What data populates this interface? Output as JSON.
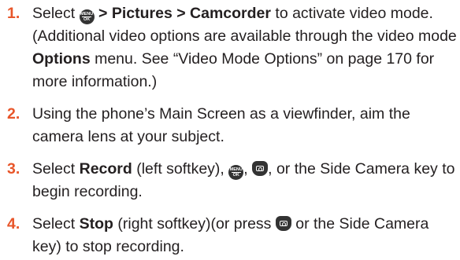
{
  "steps": [
    {
      "number": "1.",
      "t_select": "Select ",
      "menu_icon_top": "MENU",
      "menu_icon_bottom": "OK",
      "path1": " > Pictures > Camcorder",
      "t1": " to activate video mode. (Additional video options are available through the video mode ",
      "options": "Options",
      "t2": " menu. See “Video Mode Options” on page 170 for more information.)"
    },
    {
      "number": "2.",
      "text": "Using the phone’s Main Screen as a viewfinder, aim the camera lens at your subject."
    },
    {
      "number": "3.",
      "t_select": "Select ",
      "record": "Record",
      "t1": " (left softkey), ",
      "menu_icon_top": "MENU",
      "menu_icon_bottom": "OK",
      "t2": ", ",
      "t3": ", or the Side Camera key to begin recording."
    },
    {
      "number": "4.",
      "t_select": "Select ",
      "stop": "Stop",
      "t1": " (right softkey)(or press ",
      "t2": " or the Side Camera key) to stop recording."
    }
  ],
  "icons": {
    "menu_ok": "menu-ok-key-icon",
    "camera": "camera-key-icon"
  },
  "colors": {
    "step_number": "#e8562a",
    "text": "#231f20",
    "key_icon": "#333333"
  }
}
